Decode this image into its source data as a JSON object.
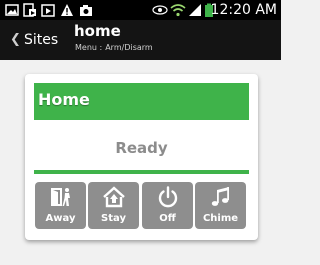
{
  "status_bar": {
    "time": "12:20 AM",
    "icons": [
      "image-icon",
      "media-icon",
      "play-store-icon",
      "warning-icon",
      "camera-icon",
      "bluetooth-icon",
      "wifi-icon",
      "signal-icon",
      "battery-icon"
    ],
    "battery_color": "#3fb34a"
  },
  "action_bar": {
    "back_label": "Sites",
    "title": "home",
    "subtitle_prefix": "Menu :",
    "subtitle_value": "Arm/Disarm"
  },
  "card": {
    "title": "home",
    "header_title": "Home",
    "status": "Ready",
    "accent_color": "#3fb34a",
    "button_color": "#8e8e8e",
    "buttons": [
      {
        "label": "Away",
        "icon": "away-icon"
      },
      {
        "label": "Stay",
        "icon": "stay-icon"
      },
      {
        "label": "Off",
        "icon": "power-icon"
      },
      {
        "label": "Chime",
        "icon": "chime-icon"
      }
    ]
  }
}
